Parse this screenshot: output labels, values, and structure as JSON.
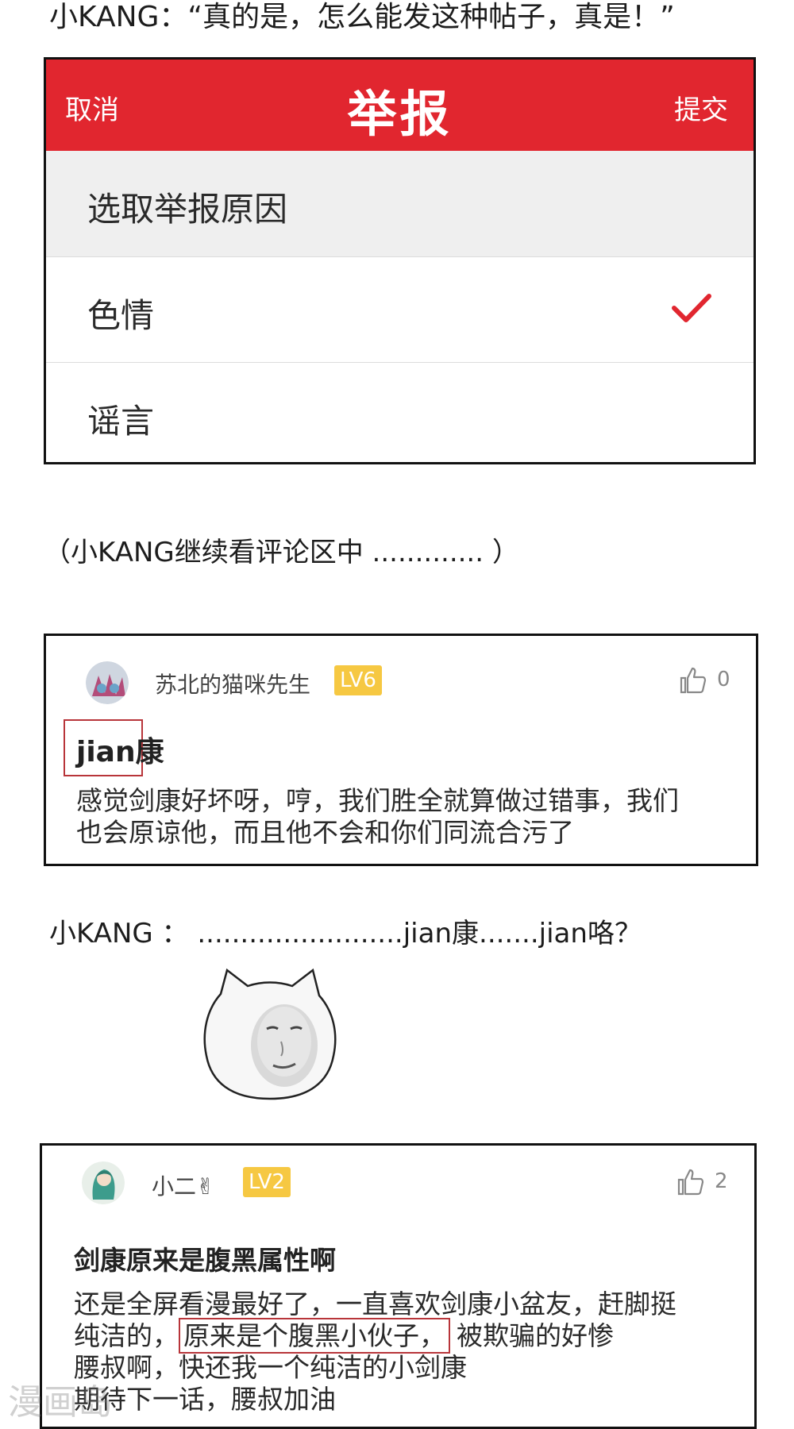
{
  "narration": {
    "line1": "小KANG：“真的是，怎么能发这种帖子，真是！”",
    "line2": "（小KANG继续看评论区中 ............. ）",
    "line3": "小KANG ： ........................jian康.......jian咯？"
  },
  "report": {
    "cancel": "取消",
    "title": "举报",
    "submit": "提交",
    "prompt": "选取举报原因",
    "reasons": [
      {
        "label": "色情",
        "selected": true
      },
      {
        "label": "谣言",
        "selected": false
      }
    ],
    "accent_color": "#e1262f"
  },
  "comments": [
    {
      "username": "苏北的猫咪先生",
      "level": "LV6",
      "likes": "0",
      "title": "jian康",
      "body_lines": [
        "感觉剑康好坏呀，哼，我们胜全就算做过错事，我们",
        "也会原谅他，而且他不会和你们同流合污了"
      ]
    },
    {
      "username": "小二✌",
      "level": "LV2",
      "likes": "2",
      "title": "剑康原来是腹黑属性啊",
      "body": {
        "line1": "还是全屏看漫最好了，一直喜欢剑康小盆友，赶脚挺",
        "line2_pre": "纯洁的，",
        "line2_highlight": "原来是个腹黑小伙子，",
        "line2_post": "被欺骗的好惨",
        "line3": "腰叔啊，快还我一个纯洁的小剑康",
        "line4": "期待下一话，腰叔加油"
      }
    }
  ],
  "watermark": "漫画岛",
  "colors": {
    "level_badge": "#f6c842",
    "highlight_border": "#b8353a"
  }
}
